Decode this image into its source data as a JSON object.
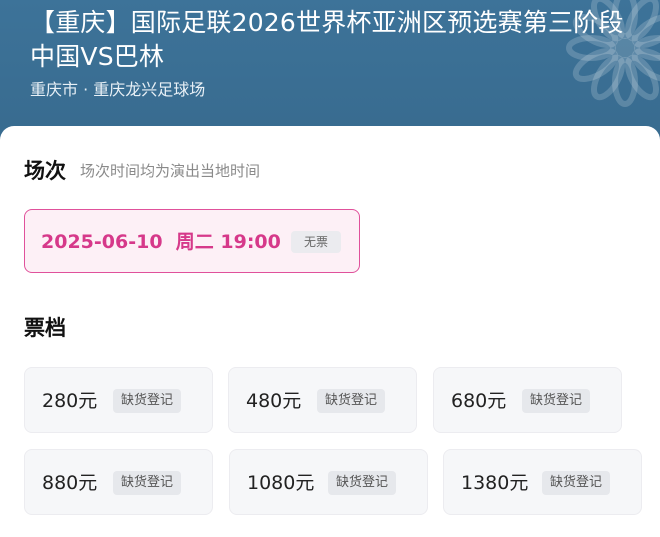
{
  "event": {
    "title": "【重庆】国际足联2026世界杯亚洲区预选赛第三阶段 中国VS巴林",
    "venue": "重庆市 · 重庆龙兴足球场"
  },
  "session_section": {
    "heading": "场次",
    "note": "场次时间均为演出当地时间",
    "selected": {
      "datetime": "2025-06-10  周二 19:00",
      "status": "无票"
    }
  },
  "tier_section": {
    "heading": "票档",
    "tiers": [
      {
        "price": "280元",
        "status": "缺货登记"
      },
      {
        "price": "480元",
        "status": "缺货登记"
      },
      {
        "price": "680元",
        "status": "缺货登记"
      },
      {
        "price": "880元",
        "status": "缺货登记"
      },
      {
        "price": "1080元",
        "status": "缺货登记"
      },
      {
        "price": "1380元",
        "status": "缺货登记"
      }
    ]
  },
  "colors": {
    "header_bg": "#3a6f93",
    "accent": "#d6398a",
    "session_border": "#e0519b"
  },
  "icons": [
    "flower-decoration-icon"
  ]
}
